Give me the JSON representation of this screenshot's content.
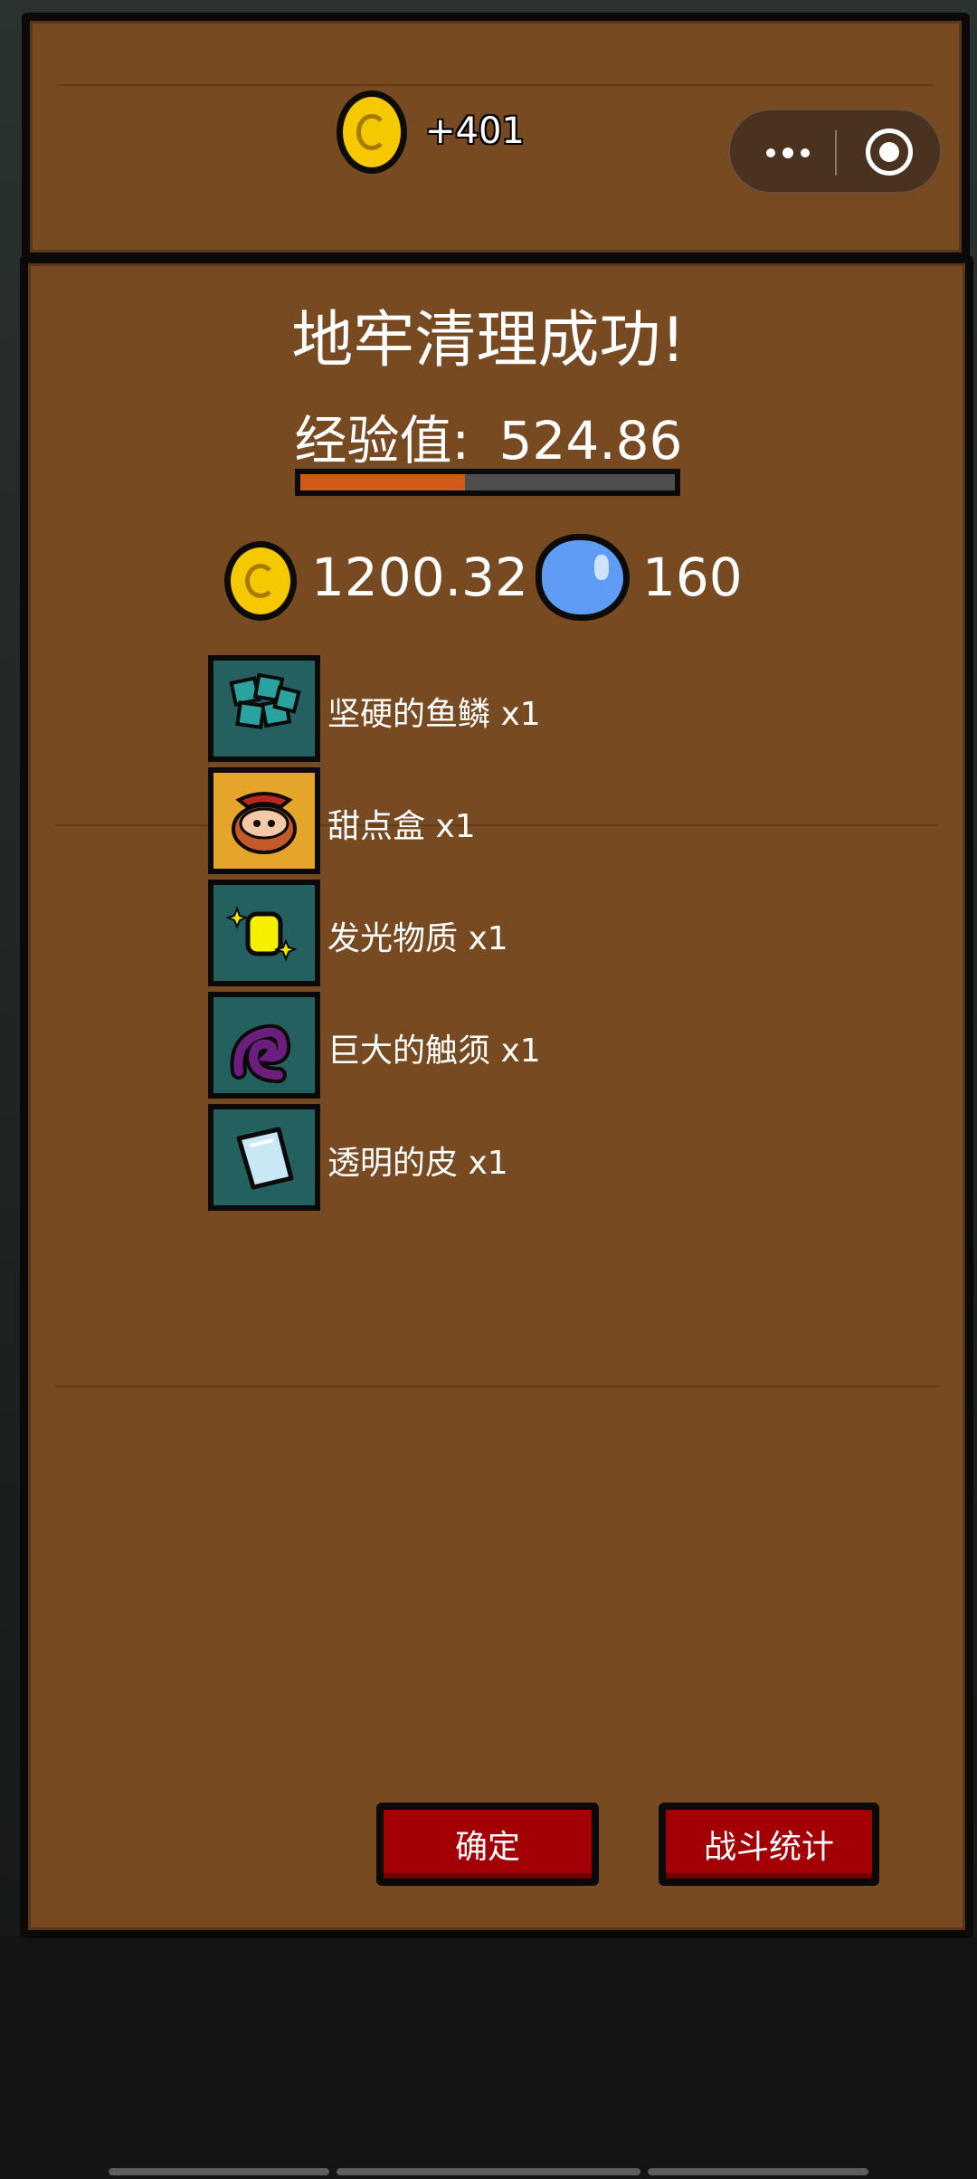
{
  "header": {
    "coin_delta": "+401"
  },
  "result": {
    "title": "地牢清理成功!",
    "exp_label": "经验值:",
    "exp_value": "524.86",
    "exp_progress": 0.44
  },
  "rewards": {
    "coins": "1200.32",
    "gems": "160"
  },
  "items": [
    {
      "label": "坚硬的鱼鳞 x1",
      "icon": "scale-icon"
    },
    {
      "label": "甜点盒 x1",
      "icon": "dessert-box-icon"
    },
    {
      "label": "发光物质 x1",
      "icon": "glowing-matter-icon"
    },
    {
      "label": "巨大的触须 x1",
      "icon": "tentacle-icon"
    },
    {
      "label": "透明的皮 x1",
      "icon": "transparent-skin-icon"
    }
  ],
  "buttons": {
    "confirm": "确定",
    "battle_stats": "战斗统计"
  },
  "colors": {
    "panel": "#774a22",
    "button": "#a30006",
    "exp_fill": "#d05a1a",
    "slot": "#256061"
  }
}
